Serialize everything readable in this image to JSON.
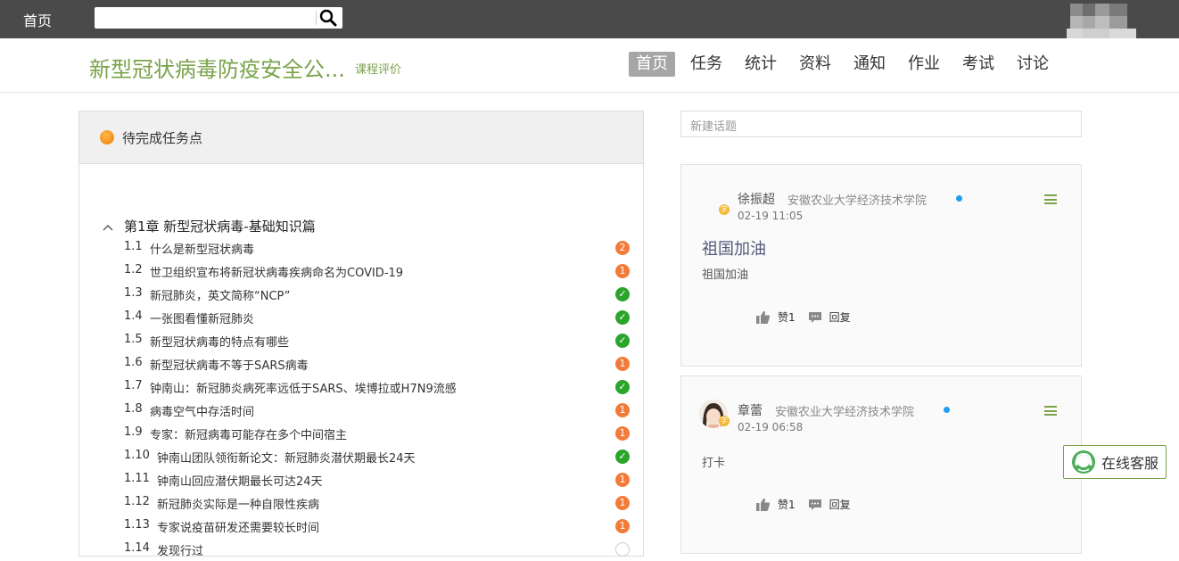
{
  "topbar": {
    "home_label": "首页",
    "search_placeholder": "",
    "search_icon": "search-icon"
  },
  "header": {
    "course_title": "新型冠状病毒防疫安全公...",
    "course_eval": "课程评价",
    "nav": [
      "首页",
      "任务",
      "统计",
      "资料",
      "通知",
      "作业",
      "考试",
      "讨论"
    ],
    "active_nav": "首页"
  },
  "tasks": {
    "heading": "待完成任务点",
    "chapter": "第1章 新型冠状病毒-基础知识篇",
    "items": [
      {
        "num": "1.1",
        "title": "什么是新型冠状病毒",
        "status": "pending",
        "count": "2"
      },
      {
        "num": "1.2",
        "title": "世卫组织宣布将新冠状病毒疾病命名为COVID-19",
        "status": "pending",
        "count": "1"
      },
      {
        "num": "1.3",
        "title": "新冠肺炎，英文简称“NCP”",
        "status": "done",
        "count": "✓"
      },
      {
        "num": "1.4",
        "title": "一张图看懂新冠肺炎",
        "status": "done",
        "count": "✓"
      },
      {
        "num": "1.5",
        "title": "新型冠状病毒的特点有哪些",
        "status": "done",
        "count": "✓"
      },
      {
        "num": "1.6",
        "title": "新型冠状病毒不等于SARS病毒",
        "status": "pending",
        "count": "1"
      },
      {
        "num": "1.7",
        "title": "钟南山：新冠肺炎病死率远低于SARS、埃博拉或H7N9流感",
        "status": "done",
        "count": "✓"
      },
      {
        "num": "1.8",
        "title": "病毒空气中存活时间",
        "status": "pending",
        "count": "1"
      },
      {
        "num": "1.9",
        "title": "专家：新冠病毒可能存在多个中间宿主",
        "status": "pending",
        "count": "1"
      },
      {
        "num": "1.10",
        "title": "钟南山团队领衔新论文：新冠肺炎潜伏期最长24天",
        "status": "done",
        "count": "✓"
      },
      {
        "num": "1.11",
        "title": "钟南山回应潜伏期最长可达24天",
        "status": "pending",
        "count": "1"
      },
      {
        "num": "1.12",
        "title": "新冠肺炎实际是一种自限性疾病",
        "status": "pending",
        "count": "1"
      },
      {
        "num": "1.13",
        "title": "专家说疫苗研发还需要较长时间",
        "status": "pending",
        "count": "1"
      },
      {
        "num": "1.14",
        "title": "发现行过",
        "status": "empty",
        "count": ""
      }
    ]
  },
  "discussion": {
    "new_topic_placeholder": "新建话题",
    "posts": [
      {
        "author": "徐振超",
        "school": "安徽农业大学经济技术学院",
        "time": "02-19 11:05",
        "role": "学",
        "title": "祖国加油",
        "body": "祖国加油",
        "like_label": "赞1",
        "reply_label": "回复"
      },
      {
        "author": "章蕾",
        "school": "安徽农业大学经济技术学院",
        "time": "02-19 06:58",
        "role": "学",
        "title": "",
        "body": "打卡",
        "like_label": "赞1",
        "reply_label": "回复"
      }
    ]
  },
  "service": {
    "label": "在线客服",
    "icon": "headset-icon"
  },
  "colors": {
    "accent": "#7aa34a",
    "topbar": "#4a4a4a",
    "pending": "#f37b39",
    "done": "#2aa52a",
    "online": "#1e9df2"
  }
}
